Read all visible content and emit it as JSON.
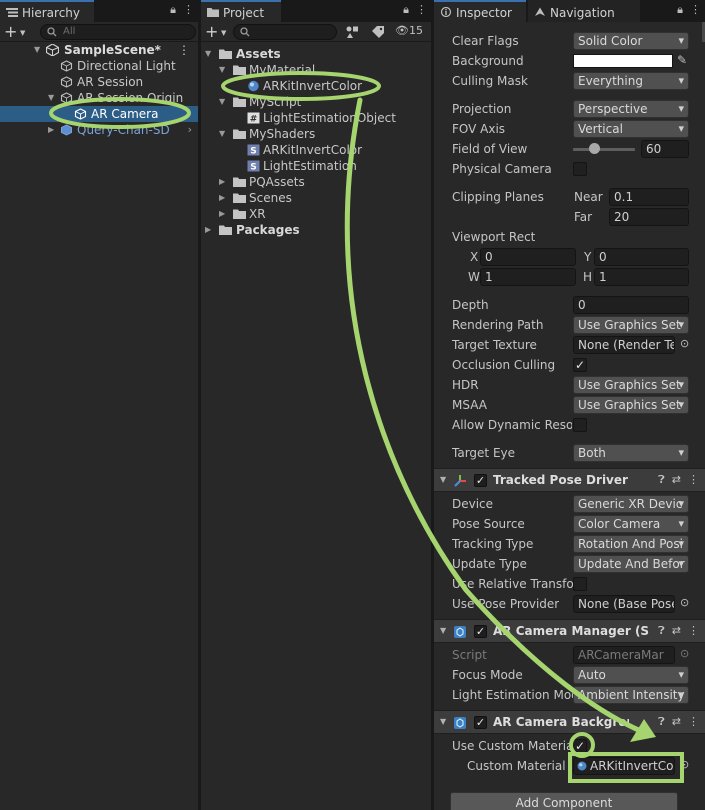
{
  "hierarchy": {
    "tab_label": "Hierarchy",
    "search_placeholder": "All",
    "items": [
      {
        "label": "SampleScene*"
      },
      {
        "label": "Directional Light"
      },
      {
        "label": "AR Session"
      },
      {
        "label": "AR Session Origin"
      },
      {
        "label": "AR Camera"
      },
      {
        "label": "Query-Chan-SD"
      }
    ]
  },
  "project": {
    "tab_label": "Project",
    "hidden_count": "15",
    "items": [
      {
        "label": "Assets"
      },
      {
        "label": "MyMaterial"
      },
      {
        "label": "ARKitInvertColor"
      },
      {
        "label": "MyScript"
      },
      {
        "label": "LightEstimationObject"
      },
      {
        "label": "MyShaders"
      },
      {
        "label": "ARKitInvertColor"
      },
      {
        "label": "LightEstimation"
      },
      {
        "label": "PQAssets"
      },
      {
        "label": "Scenes"
      },
      {
        "label": "XR"
      },
      {
        "label": "Packages"
      }
    ]
  },
  "inspector": {
    "tabs": [
      {
        "label": "Inspector"
      },
      {
        "label": "Navigation"
      }
    ],
    "camera": {
      "clear_flags": {
        "label": "Clear Flags",
        "value": "Solid Color"
      },
      "background": {
        "label": "Background"
      },
      "culling_mask": {
        "label": "Culling Mask",
        "value": "Everything"
      },
      "projection": {
        "label": "Projection",
        "value": "Perspective"
      },
      "fov_axis": {
        "label": "FOV Axis",
        "value": "Vertical"
      },
      "field_of_view": {
        "label": "Field of View",
        "value": "60",
        "fraction": 0.35
      },
      "physical_camera": {
        "label": "Physical Camera",
        "checked": false
      },
      "clipping": {
        "label": "Clipping Planes",
        "near_label": "Near",
        "near": "0.1",
        "far_label": "Far",
        "far": "20"
      },
      "viewport": {
        "label": "Viewport Rect",
        "x_label": "X",
        "x": "0",
        "y_label": "Y",
        "y": "0",
        "w_label": "W",
        "w": "1",
        "h_label": "H",
        "h": "1"
      },
      "depth": {
        "label": "Depth",
        "value": "0"
      },
      "rendering_path": {
        "label": "Rendering Path",
        "value": "Use Graphics Set"
      },
      "target_texture": {
        "label": "Target Texture",
        "value": "None (Render Te"
      },
      "occlusion_culling": {
        "label": "Occlusion Culling",
        "checked": true,
        "mark": "✓"
      },
      "hdr": {
        "label": "HDR",
        "value": "Use Graphics Set"
      },
      "msaa": {
        "label": "MSAA",
        "value": "Use Graphics Set"
      },
      "allow_dynamic": {
        "label": "Allow Dynamic Resol",
        "checked": false
      },
      "target_eye": {
        "label": "Target Eye",
        "value": "Both"
      }
    },
    "tracked_pose": {
      "title": "Tracked Pose Driver",
      "enabled_mark": "✓",
      "device": {
        "label": "Device",
        "value": "Generic XR Devic"
      },
      "pose_source": {
        "label": "Pose Source",
        "value": "Color Camera"
      },
      "tracking_type": {
        "label": "Tracking Type",
        "value": "Rotation And Posi"
      },
      "update_type": {
        "label": "Update Type",
        "value": "Update And Befor"
      },
      "use_relative": {
        "label": "Use Relative Transfor",
        "checked": false
      },
      "use_pose_provider": {
        "label": "Use Pose Provider",
        "value": "None (Base Pose"
      }
    },
    "camera_manager": {
      "title": "AR Camera Manager (S",
      "enabled_mark": "✓",
      "script": {
        "label": "Script",
        "value": "ARCameraMar"
      },
      "focus_mode": {
        "label": "Focus Mode",
        "value": "Auto"
      },
      "light_estimation": {
        "label": "Light Estimation Mod",
        "value": "Ambient Intensity"
      }
    },
    "camera_background": {
      "title": "AR Camera Backgrounc",
      "enabled_mark": "✓",
      "use_custom": {
        "label": "Use Custom Material",
        "checked": true,
        "mark": "✓"
      },
      "custom_material": {
        "label": "Custom Material",
        "value": "ARKitInvertCol"
      }
    },
    "add_component": "Add Component"
  },
  "colors": {
    "annotation_green": "#a6d46f",
    "selection_blue": "#2c5d87",
    "panel_bg": "#282828"
  }
}
